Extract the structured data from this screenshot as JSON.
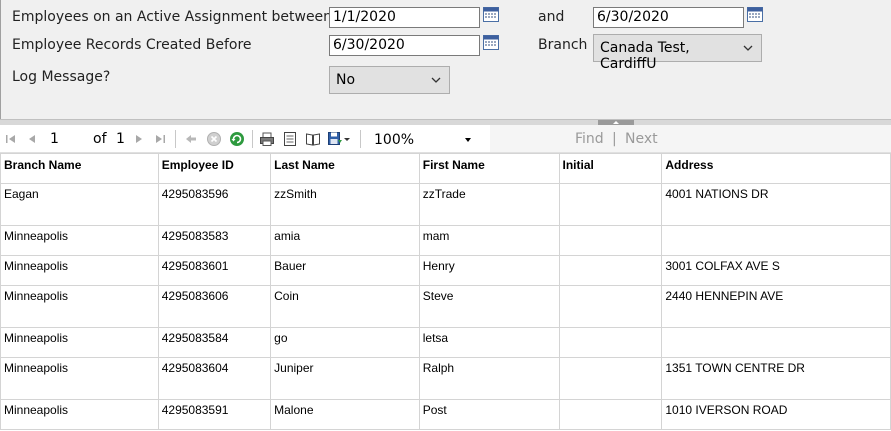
{
  "params": {
    "active_between_label": "Employees on an Active Assignment between",
    "start_date": "1/1/2020",
    "and_label": "and",
    "end_date": "6/30/2020",
    "created_before_label": "Employee Records Created Before",
    "created_before_date": "6/30/2020",
    "branch_label": "Branch",
    "branch_value": "Canada Test, CardiffU",
    "log_label": "Log Message?",
    "log_value": "No"
  },
  "toolbar": {
    "page": "1",
    "of_label": "of",
    "total_pages": "1",
    "zoom": "100%",
    "find_label": "Find",
    "separator": "|",
    "next_label": "Next"
  },
  "table": {
    "columns": [
      "Branch Name",
      "Employee ID",
      "Last Name",
      "First Name",
      "Initial",
      "Address"
    ],
    "rows": [
      [
        "Eagan",
        "4295083596",
        "zzSmith",
        "zzTrade",
        "",
        "4001 NATIONS DR"
      ],
      [
        "Minneapolis",
        "4295083583",
        "amia",
        "mam",
        "",
        ""
      ],
      [
        "Minneapolis",
        "4295083601",
        "Bauer",
        "Henry",
        "",
        "3001 COLFAX AVE S"
      ],
      [
        "Minneapolis",
        "4295083606",
        "Coin",
        "Steve",
        "",
        "2440 HENNEPIN AVE"
      ],
      [
        "Minneapolis",
        "4295083584",
        "go",
        "letsa",
        "",
        ""
      ],
      [
        "Minneapolis",
        "4295083604",
        "Juniper",
        "Ralph",
        "",
        "1351 TOWN CENTRE DR"
      ],
      [
        "Minneapolis",
        "4295083591",
        "Malone",
        "Post",
        "",
        "1010 IVERSON ROAD"
      ]
    ]
  }
}
